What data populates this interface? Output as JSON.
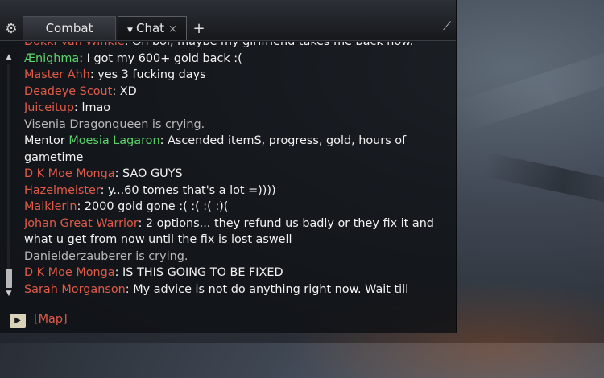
{
  "tabs": [
    {
      "label": "Combat"
    },
    {
      "label": "Chat"
    }
  ],
  "icons": {
    "settings": "gear-icon",
    "add_tab": "plus-icon",
    "close_tab": "close-icon",
    "tab_menu": "caret-down-icon",
    "resize": "resize-corner-icon",
    "send": "play-icon"
  },
  "colors": {
    "player_name": "#e05a48",
    "guild_name": "#5bd36a",
    "text": "#f2f2f2",
    "emote": "#b9b9b9"
  },
  "messages": [
    {
      "sender": "Dokki Van Winkle",
      "text": ": Oh boi, maybe my girlfriend takes me back now."
    },
    {
      "sender": "Ænighma",
      "text": ": I got my 600+ gold back :("
    },
    {
      "sender": "Master Ahh",
      "text": ": yes 3 fucking days"
    },
    {
      "sender": "Deadeye Scout",
      "text": ": XD"
    },
    {
      "sender": "Juiceitup",
      "text": ": lmao"
    },
    {
      "emote": "Visenia Dragonqueen is crying."
    },
    {
      "prefix": "Mentor ",
      "sender": "Moesia Lagaron",
      "text": ": Ascended itemS, progress, gold, hours of gametime"
    },
    {
      "sender": "D K Moe Monga",
      "text": ": SAO GUYS"
    },
    {
      "sender": "Hazelmeister",
      "text": ": y...60 tomes that's a lot =))))"
    },
    {
      "sender": "Maiklerin",
      "text": ": 2000 gold gone :( :( :( :)("
    },
    {
      "sender": "Johan Great Warrior",
      "text": ": 2 options... they refund us badly or they fix it and what u get from now until the fix is lost aswell"
    },
    {
      "emote": "Danielderzauberer is crying."
    },
    {
      "sender": "D K Moe Monga",
      "text": ": IS THIS GOING TO BE FIXED"
    },
    {
      "sender": "Sarah Morganson",
      "text": ": My advice is not do anything right now. Wait till"
    }
  ],
  "input": {
    "link_text": "[Map]"
  }
}
